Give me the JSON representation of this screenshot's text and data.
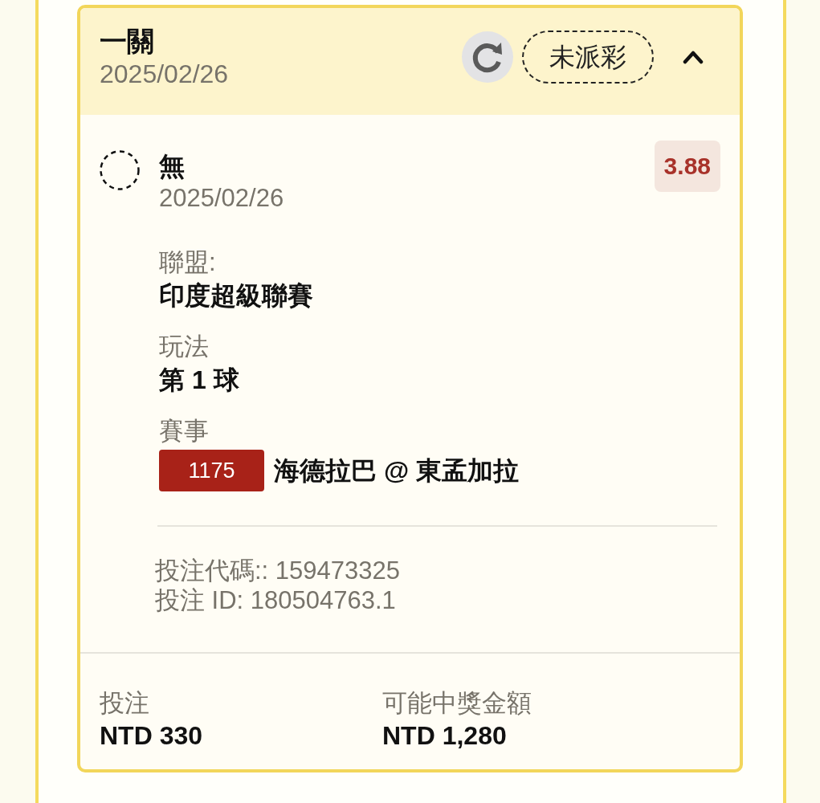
{
  "bet": {
    "title": "一關",
    "date": "2025/02/26",
    "status": "未派彩",
    "expanded": true
  },
  "selection": {
    "name": "無",
    "date": "2025/02/26",
    "odds": "3.88"
  },
  "details": [
    {
      "kind": "text",
      "label": "聯盟:",
      "value": "印度超級聯賽"
    },
    {
      "kind": "text",
      "label": "玩法",
      "value": "第 1 球"
    },
    {
      "kind": "match",
      "label": "賽事",
      "match_no": "1175",
      "value": "海德拉巴 @ 東孟加拉"
    }
  ],
  "references": [
    "投注代碼:: 159473325",
    "投注 ID: 180504763.1"
  ],
  "totals": [
    {
      "label": "投注",
      "value": "NTD 330"
    },
    {
      "label": "可能中獎金額",
      "value": "NTD 1,280"
    }
  ]
}
